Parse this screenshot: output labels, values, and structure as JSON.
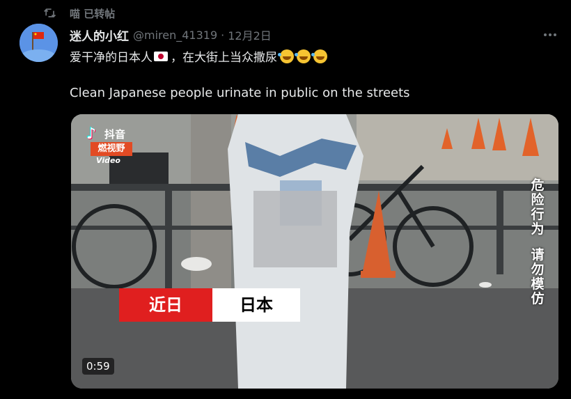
{
  "repost": {
    "label": "喵 已转帖"
  },
  "post": {
    "author_name": "迷人的小红",
    "handle": "@miren_41319",
    "separator": "·",
    "date": "12月2日",
    "text_cn_part1": "爱干净的日本人",
    "text_cn_part2": "，在大街上当众撒尿",
    "text_en": "Clean Japanese people urinate in public on the streets"
  },
  "video": {
    "watermark_tiktok_glyph": "♪",
    "watermark_brand": "抖音",
    "watermark_sub": "燃视野",
    "watermark_video": "Video",
    "caption_left": "近日",
    "caption_right": "日本",
    "side_text_1": "危险行为",
    "side_text_2": "请勿模仿",
    "duration": "0:59"
  },
  "icons": {
    "repost": "repost-icon",
    "more": "more-options-icon",
    "flag": "japan-flag-emoji",
    "emoji": "rolling-laughing-emoji"
  },
  "colors": {
    "background": "#000000",
    "text": "#e7e9ea",
    "muted": "#71767b",
    "caption_red": "#e01f1f"
  }
}
